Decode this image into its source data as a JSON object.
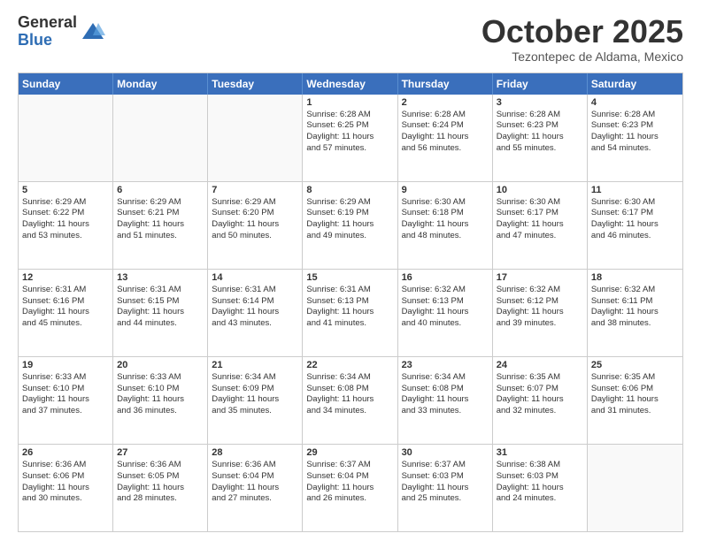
{
  "header": {
    "logo": {
      "general": "General",
      "blue": "Blue"
    },
    "title": "October 2025",
    "location": "Tezontepec de Aldama, Mexico"
  },
  "weekdays": [
    "Sunday",
    "Monday",
    "Tuesday",
    "Wednesday",
    "Thursday",
    "Friday",
    "Saturday"
  ],
  "rows": [
    [
      {
        "day": "",
        "lines": []
      },
      {
        "day": "",
        "lines": []
      },
      {
        "day": "",
        "lines": []
      },
      {
        "day": "1",
        "lines": [
          "Sunrise: 6:28 AM",
          "Sunset: 6:25 PM",
          "Daylight: 11 hours",
          "and 57 minutes."
        ]
      },
      {
        "day": "2",
        "lines": [
          "Sunrise: 6:28 AM",
          "Sunset: 6:24 PM",
          "Daylight: 11 hours",
          "and 56 minutes."
        ]
      },
      {
        "day": "3",
        "lines": [
          "Sunrise: 6:28 AM",
          "Sunset: 6:23 PM",
          "Daylight: 11 hours",
          "and 55 minutes."
        ]
      },
      {
        "day": "4",
        "lines": [
          "Sunrise: 6:28 AM",
          "Sunset: 6:23 PM",
          "Daylight: 11 hours",
          "and 54 minutes."
        ]
      }
    ],
    [
      {
        "day": "5",
        "lines": [
          "Sunrise: 6:29 AM",
          "Sunset: 6:22 PM",
          "Daylight: 11 hours",
          "and 53 minutes."
        ]
      },
      {
        "day": "6",
        "lines": [
          "Sunrise: 6:29 AM",
          "Sunset: 6:21 PM",
          "Daylight: 11 hours",
          "and 51 minutes."
        ]
      },
      {
        "day": "7",
        "lines": [
          "Sunrise: 6:29 AM",
          "Sunset: 6:20 PM",
          "Daylight: 11 hours",
          "and 50 minutes."
        ]
      },
      {
        "day": "8",
        "lines": [
          "Sunrise: 6:29 AM",
          "Sunset: 6:19 PM",
          "Daylight: 11 hours",
          "and 49 minutes."
        ]
      },
      {
        "day": "9",
        "lines": [
          "Sunrise: 6:30 AM",
          "Sunset: 6:18 PM",
          "Daylight: 11 hours",
          "and 48 minutes."
        ]
      },
      {
        "day": "10",
        "lines": [
          "Sunrise: 6:30 AM",
          "Sunset: 6:17 PM",
          "Daylight: 11 hours",
          "and 47 minutes."
        ]
      },
      {
        "day": "11",
        "lines": [
          "Sunrise: 6:30 AM",
          "Sunset: 6:17 PM",
          "Daylight: 11 hours",
          "and 46 minutes."
        ]
      }
    ],
    [
      {
        "day": "12",
        "lines": [
          "Sunrise: 6:31 AM",
          "Sunset: 6:16 PM",
          "Daylight: 11 hours",
          "and 45 minutes."
        ]
      },
      {
        "day": "13",
        "lines": [
          "Sunrise: 6:31 AM",
          "Sunset: 6:15 PM",
          "Daylight: 11 hours",
          "and 44 minutes."
        ]
      },
      {
        "day": "14",
        "lines": [
          "Sunrise: 6:31 AM",
          "Sunset: 6:14 PM",
          "Daylight: 11 hours",
          "and 43 minutes."
        ]
      },
      {
        "day": "15",
        "lines": [
          "Sunrise: 6:31 AM",
          "Sunset: 6:13 PM",
          "Daylight: 11 hours",
          "and 41 minutes."
        ]
      },
      {
        "day": "16",
        "lines": [
          "Sunrise: 6:32 AM",
          "Sunset: 6:13 PM",
          "Daylight: 11 hours",
          "and 40 minutes."
        ]
      },
      {
        "day": "17",
        "lines": [
          "Sunrise: 6:32 AM",
          "Sunset: 6:12 PM",
          "Daylight: 11 hours",
          "and 39 minutes."
        ]
      },
      {
        "day": "18",
        "lines": [
          "Sunrise: 6:32 AM",
          "Sunset: 6:11 PM",
          "Daylight: 11 hours",
          "and 38 minutes."
        ]
      }
    ],
    [
      {
        "day": "19",
        "lines": [
          "Sunrise: 6:33 AM",
          "Sunset: 6:10 PM",
          "Daylight: 11 hours",
          "and 37 minutes."
        ]
      },
      {
        "day": "20",
        "lines": [
          "Sunrise: 6:33 AM",
          "Sunset: 6:10 PM",
          "Daylight: 11 hours",
          "and 36 minutes."
        ]
      },
      {
        "day": "21",
        "lines": [
          "Sunrise: 6:34 AM",
          "Sunset: 6:09 PM",
          "Daylight: 11 hours",
          "and 35 minutes."
        ]
      },
      {
        "day": "22",
        "lines": [
          "Sunrise: 6:34 AM",
          "Sunset: 6:08 PM",
          "Daylight: 11 hours",
          "and 34 minutes."
        ]
      },
      {
        "day": "23",
        "lines": [
          "Sunrise: 6:34 AM",
          "Sunset: 6:08 PM",
          "Daylight: 11 hours",
          "and 33 minutes."
        ]
      },
      {
        "day": "24",
        "lines": [
          "Sunrise: 6:35 AM",
          "Sunset: 6:07 PM",
          "Daylight: 11 hours",
          "and 32 minutes."
        ]
      },
      {
        "day": "25",
        "lines": [
          "Sunrise: 6:35 AM",
          "Sunset: 6:06 PM",
          "Daylight: 11 hours",
          "and 31 minutes."
        ]
      }
    ],
    [
      {
        "day": "26",
        "lines": [
          "Sunrise: 6:36 AM",
          "Sunset: 6:06 PM",
          "Daylight: 11 hours",
          "and 30 minutes."
        ]
      },
      {
        "day": "27",
        "lines": [
          "Sunrise: 6:36 AM",
          "Sunset: 6:05 PM",
          "Daylight: 11 hours",
          "and 28 minutes."
        ]
      },
      {
        "day": "28",
        "lines": [
          "Sunrise: 6:36 AM",
          "Sunset: 6:04 PM",
          "Daylight: 11 hours",
          "and 27 minutes."
        ]
      },
      {
        "day": "29",
        "lines": [
          "Sunrise: 6:37 AM",
          "Sunset: 6:04 PM",
          "Daylight: 11 hours",
          "and 26 minutes."
        ]
      },
      {
        "day": "30",
        "lines": [
          "Sunrise: 6:37 AM",
          "Sunset: 6:03 PM",
          "Daylight: 11 hours",
          "and 25 minutes."
        ]
      },
      {
        "day": "31",
        "lines": [
          "Sunrise: 6:38 AM",
          "Sunset: 6:03 PM",
          "Daylight: 11 hours",
          "and 24 minutes."
        ]
      },
      {
        "day": "",
        "lines": []
      }
    ]
  ]
}
